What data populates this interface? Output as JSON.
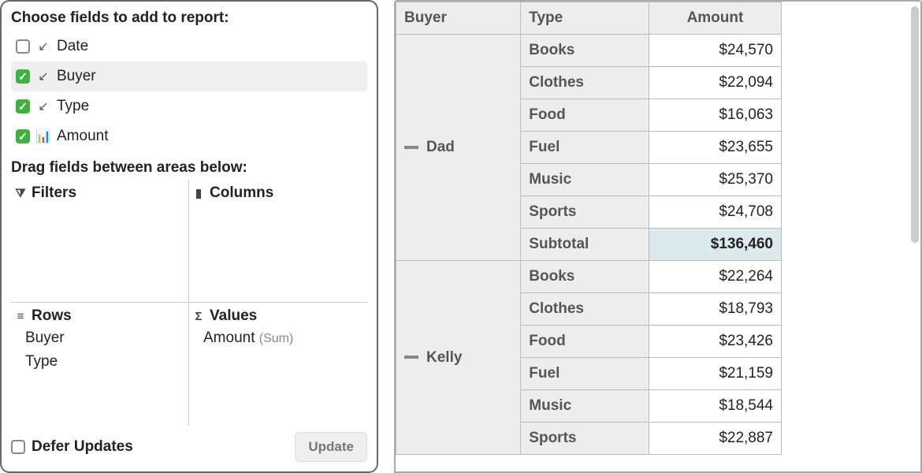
{
  "fieldChooser": {
    "title": "Choose fields to add to report:",
    "fields": [
      {
        "label": "Date",
        "checked": false,
        "iconName": "arrow-bl-icon",
        "glyph": "↙"
      },
      {
        "label": "Buyer",
        "checked": true,
        "iconName": "arrow-bl-icon",
        "glyph": "↙",
        "highlight": true
      },
      {
        "label": "Type",
        "checked": true,
        "iconName": "arrow-bl-icon",
        "glyph": "↙"
      },
      {
        "label": "Amount",
        "checked": true,
        "iconName": "bar-chart-icon",
        "glyph": "📊"
      }
    ],
    "dragLabel": "Drag fields between areas below:",
    "areas": {
      "filters": {
        "title": "Filters",
        "iconGlyph": "⧩",
        "iconName": "funnel-icon",
        "items": []
      },
      "columns": {
        "title": "Columns",
        "iconGlyph": "▮",
        "iconName": "column-icon",
        "items": []
      },
      "rows": {
        "title": "Rows",
        "iconGlyph": "≡",
        "iconName": "rows-icon",
        "items": [
          "Buyer",
          "Type"
        ]
      },
      "values": {
        "title": "Values",
        "iconGlyph": "Σ",
        "iconName": "sigma-icon",
        "items": [
          {
            "field": "Amount",
            "agg": "(Sum)"
          }
        ]
      }
    },
    "deferLabel": "Defer Updates",
    "deferChecked": false,
    "updateLabel": "Update"
  },
  "pivot": {
    "headers": {
      "buyer": "Buyer",
      "type": "Type",
      "amount": "Amount"
    },
    "groups": [
      {
        "buyer": "Dad",
        "rows": [
          {
            "type": "Books",
            "amount": "$24,570"
          },
          {
            "type": "Clothes",
            "amount": "$22,094"
          },
          {
            "type": "Food",
            "amount": "$16,063"
          },
          {
            "type": "Fuel",
            "amount": "$23,655"
          },
          {
            "type": "Music",
            "amount": "$25,370"
          },
          {
            "type": "Sports",
            "amount": "$24,708"
          }
        ],
        "subtotalLabel": "Subtotal",
        "subtotal": "$136,460"
      },
      {
        "buyer": "Kelly",
        "rows": [
          {
            "type": "Books",
            "amount": "$22,264"
          },
          {
            "type": "Clothes",
            "amount": "$18,793"
          },
          {
            "type": "Food",
            "amount": "$23,426"
          },
          {
            "type": "Fuel",
            "amount": "$21,159"
          },
          {
            "type": "Music",
            "amount": "$18,544"
          },
          {
            "type": "Sports",
            "amount": "$22,887"
          }
        ]
      }
    ]
  }
}
